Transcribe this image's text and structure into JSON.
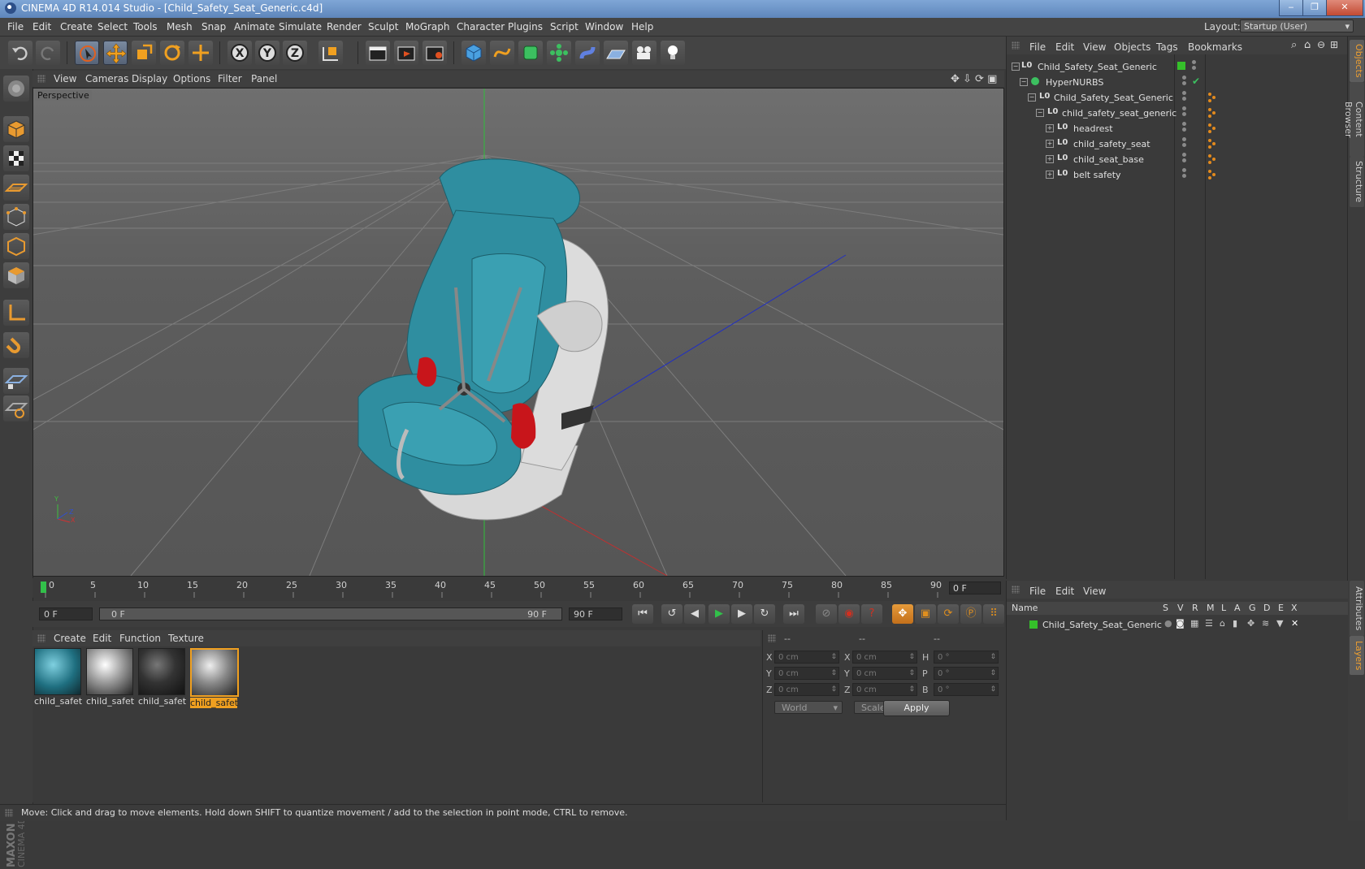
{
  "window": {
    "title": "CINEMA 4D R14.014 Studio - [Child_Safety_Seat_Generic.c4d]",
    "min": "‒",
    "max": "❐",
    "close": "✕"
  },
  "menubar": {
    "items": [
      "File",
      "Edit",
      "Create",
      "Select",
      "Tools",
      "Mesh",
      "Snap",
      "Animate",
      "Simulate",
      "Render",
      "Sculpt",
      "MoGraph",
      "Character",
      "Plugins",
      "Script",
      "Window",
      "Help"
    ],
    "layout_label": "Layout:",
    "layout_value": "Startup (User)"
  },
  "viewport": {
    "menu": [
      "View",
      "Cameras",
      "Display",
      "Options",
      "Filter",
      "Panel"
    ],
    "label": "Perspective",
    "axis_y": "Y",
    "axis_x": "X",
    "axis_z": "Z"
  },
  "timeline": {
    "ticks": [
      "0",
      "5",
      "10",
      "15",
      "20",
      "25",
      "30",
      "35",
      "40",
      "45",
      "50",
      "55",
      "60",
      "65",
      "70",
      "75",
      "80",
      "85",
      "90"
    ],
    "current_frame": "0 F"
  },
  "playback": {
    "start_frame": "0 F",
    "range_start": "0 F",
    "range_end": "90 F",
    "end_frame": "90 F"
  },
  "materials": {
    "menu": [
      "Create",
      "Edit",
      "Function",
      "Texture"
    ],
    "items": [
      "child_safet",
      "child_safet",
      "child_safet",
      "child_safet"
    ]
  },
  "coords": {
    "headers": [
      "--",
      "--",
      "--"
    ],
    "rows": [
      {
        "l1": "X",
        "v1": "0 cm",
        "l2": "X",
        "v2": "0 cm",
        "l3": "H",
        "v3": "0 °"
      },
      {
        "l1": "Y",
        "v1": "0 cm",
        "l2": "Y",
        "v2": "0 cm",
        "l3": "P",
        "v3": "0 °"
      },
      {
        "l1": "Z",
        "v1": "0 cm",
        "l2": "Z",
        "v2": "0 cm",
        "l3": "B",
        "v3": "0 °"
      }
    ],
    "world": "World",
    "scale": "Scale",
    "apply": "Apply"
  },
  "objects": {
    "menu": [
      "File",
      "Edit",
      "View",
      "Objects",
      "Tags",
      "Bookmarks"
    ],
    "rows": [
      "Child_Safety_Seat_Generic",
      "HyperNURBS",
      "Child_Safety_Seat_Generic",
      "child_safety_seat_generic",
      "headrest",
      "child_safety_seat",
      "child_seat_base",
      "belt safety"
    ]
  },
  "sidetabs": [
    "Objects",
    "Content Browser",
    "Structure",
    "Attributes",
    "Layers"
  ],
  "layers": {
    "menu": [
      "File",
      "Edit",
      "View"
    ],
    "columns": [
      "Name",
      "S",
      "V",
      "R",
      "M",
      "L",
      "A",
      "G",
      "D",
      "E",
      "X"
    ],
    "row": "Child_Safety_Seat_Generic"
  },
  "status": "Move: Click and drag to move elements. Hold down SHIFT to quantize movement / add to the selection in point mode, CTRL to remove.",
  "colors": {
    "accent": "#e08f1e",
    "seat_teal": "#2f8ea0",
    "seat_red": "#c8151b",
    "green_tag": "#35c02a"
  }
}
